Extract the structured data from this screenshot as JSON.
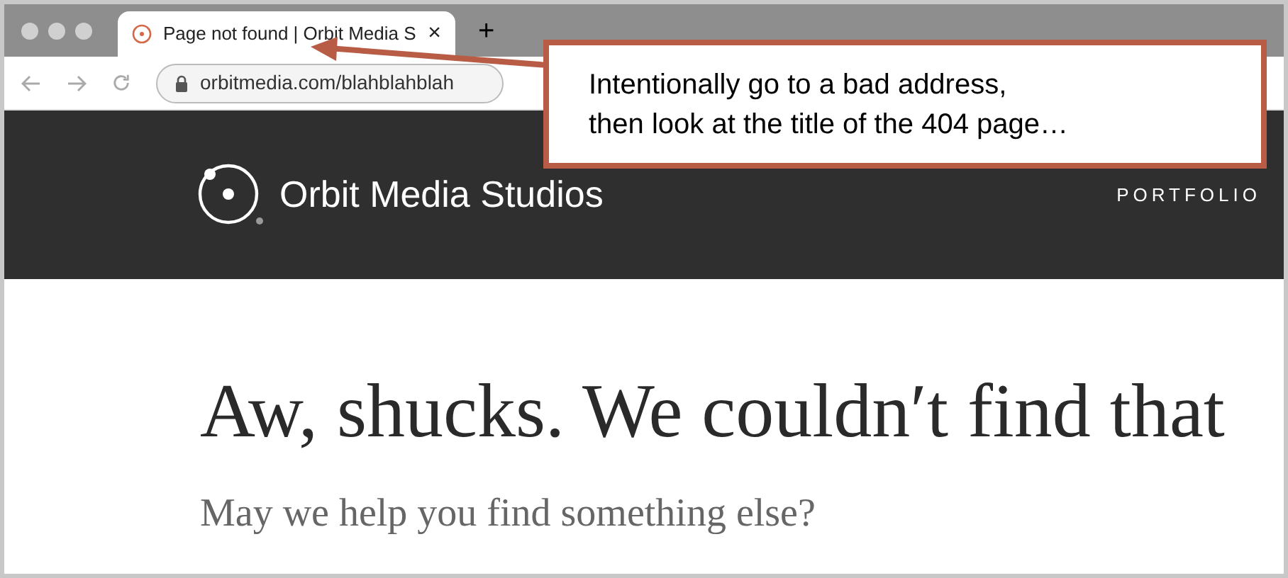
{
  "browser": {
    "tab": {
      "title": "Page not found | Orbit Media S",
      "selected": true
    },
    "new_tab": "+",
    "close_tab": "×",
    "address": "orbitmedia.com/blahblahblah"
  },
  "site_header": {
    "logo_text": "Orbit Media Studios",
    "nav": [
      {
        "label": "PORTFOLIO"
      }
    ]
  },
  "content": {
    "heading": "Aw, shucks. We couldn′t find that",
    "subheading": "May we help you find something else?"
  },
  "callout": {
    "lines": [
      "Intentionally go to a bad address,",
      "then look at the title of the 404 page…"
    ]
  }
}
